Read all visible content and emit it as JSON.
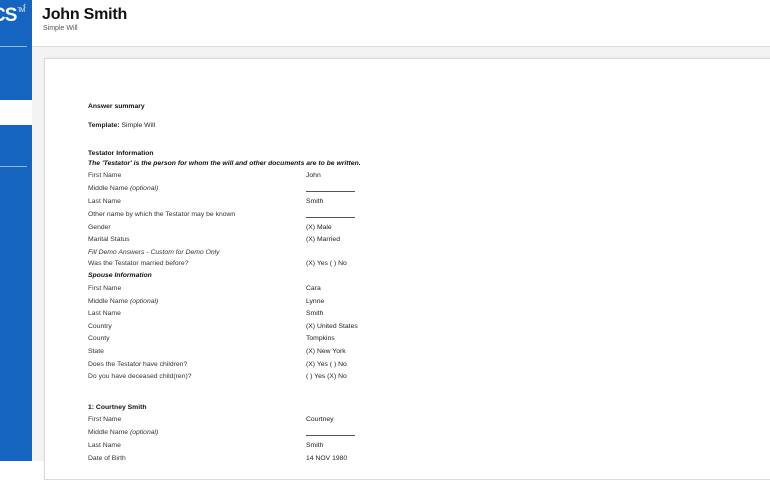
{
  "sidebar": {
    "logo_text": "CS",
    "logo_tm": "TM",
    "collapse_glyph": "‹"
  },
  "header": {
    "title": "John Smith",
    "subtitle": "Simple Will"
  },
  "summary": {
    "heading": "Answer summary",
    "template_label": "Template:",
    "template_value": "Simple Will"
  },
  "testator": {
    "heading": "Testator Information",
    "description": "The 'Testator' is the person for whom the will and other documents are to be written.",
    "first_name_label": "First Name",
    "first_name_value": "John",
    "middle_name_label": "Middle Name",
    "optional_label": "(optional)",
    "last_name_label": "Last Name",
    "last_name_value": "Smith",
    "other_name_label": "Other name by which the Testator may be known",
    "gender_label": "Gender",
    "gender_value": "(X) Male",
    "marital_label": "Marital Status",
    "marital_value": "(X) Married",
    "fill_demo_label": "Fill Demo Answers - Custom for Demo Only",
    "married_before_label": "Was the Testator married before?",
    "married_before_value": "(X) Yes ( ) No"
  },
  "spouse": {
    "heading": "Spouse Information",
    "first_name_label": "First Name",
    "first_name_value": "Cara",
    "middle_name_label": "Middle Name",
    "optional_label": "(optional)",
    "middle_name_value": "Lynne",
    "last_name_label": "Last Name",
    "last_name_value": "Smith",
    "country_label": "Country",
    "country_value": "(X) United States",
    "county_label": "County",
    "county_value": "Tompkins",
    "state_label": "State",
    "state_value": "(X) New York",
    "children_label": "Does the Testator have children?",
    "children_value": "(X) Yes ( ) No",
    "deceased_label": "Do you have deceased child(ren)?",
    "deceased_value": "( ) Yes (X) No"
  },
  "child1": {
    "heading": "1: Courtney Smith",
    "first_name_label": "First Name",
    "first_name_value": "Courtney",
    "middle_name_label": "Middle Name",
    "optional_label": "(optional)",
    "last_name_label": "Last Name",
    "last_name_value": "Smith",
    "dob_label": "Date of Birth",
    "dob_value": "14 NOV 1980"
  }
}
